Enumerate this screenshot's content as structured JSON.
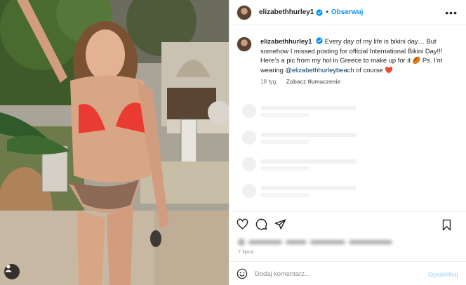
{
  "colors": {
    "accent": "#0095f6",
    "link": "#00376b",
    "verified": "#0095f6",
    "heart": "#ed4956",
    "muted": "#737373",
    "divider": "#efefef",
    "publish_disabled": "#b2dffc"
  },
  "photo": {
    "description_icon": "user-tag-icon"
  },
  "header": {
    "username": "elizabethhurley1",
    "separator": "•",
    "follow_label": "Obserwuj",
    "more_icon": "more-horizontal-icon"
  },
  "caption": {
    "username": "elizabethhurley1",
    "text_part1": "Every day of my life is bikini day… But somehow I missed posting for official International Bikini Day!!! Here’s a pic from my hol in Greece to make up for it",
    "emoji_1": "🏉",
    "text_part2": "Ps. I’m wearing",
    "mention": "@elizabethhurleybeach",
    "text_part3": "of course",
    "emoji_2": "❤️",
    "time_ago": "18 tyg.",
    "translate_label": "Zobacz tłumaczenie"
  },
  "actions": {
    "like_icon": "heart-icon",
    "comment_icon": "comment-icon",
    "share_icon": "share-icon",
    "save_icon": "bookmark-icon"
  },
  "post_date": "7 lipca",
  "comment_box": {
    "emoji_icon": "emoji-icon",
    "placeholder": "Dodaj komentarz...",
    "publish_label": "Opublikuj"
  }
}
